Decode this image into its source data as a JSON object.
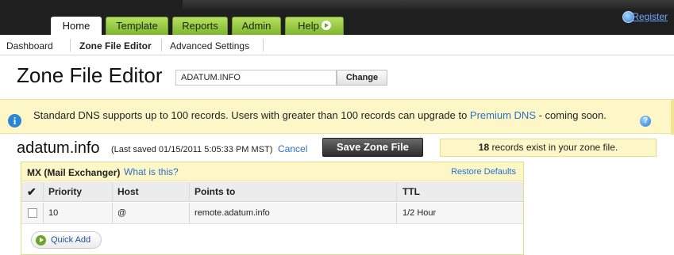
{
  "nav": {
    "tabs": [
      {
        "label": "Home",
        "active": true
      },
      {
        "label": "Template",
        "active": false
      },
      {
        "label": "Reports",
        "active": false
      },
      {
        "label": "Admin",
        "active": false
      },
      {
        "label": "Help",
        "active": false
      }
    ],
    "register_label": "Register"
  },
  "subnav": {
    "items": [
      {
        "label": "Dashboard",
        "active": false
      },
      {
        "label": "Zone File Editor",
        "active": true
      },
      {
        "label": "Advanced Settings",
        "active": false
      }
    ]
  },
  "page": {
    "title": "Zone File Editor",
    "domain_value": "ADATUM.INFO",
    "change_label": "Change"
  },
  "banner": {
    "icon": "info-icon",
    "message": "Standard DNS supports up to 100 records. Users with greater than 100 records can upgrade to ",
    "link": "Premium DNS",
    "suffix": " - coming soon."
  },
  "domain_row": {
    "domain": "adatum.info",
    "last_saved": "(Last saved 01/15/2011 5:05:33 PM MST)",
    "cancel_label": "Cancel",
    "save_label": "Save Zone File",
    "records_count": "18",
    "records_text": " records exist in your zone file."
  },
  "mx_panel": {
    "title": "MX (Mail Exchanger)",
    "what_link": "What is this?",
    "restore_label": "Restore Defaults",
    "columns": [
      "Priority",
      "Host",
      "Points to",
      "TTL"
    ],
    "rows": [
      {
        "priority": "10",
        "host": "@",
        "points_to": "remote.adatum.info",
        "ttl": "1/2 Hour"
      }
    ],
    "quick_add_label": "Quick Add"
  },
  "colors": {
    "tab_green": "#8cc63f",
    "banner_yellow": "#fdf7c8",
    "link_blue": "#2a6fc9"
  }
}
